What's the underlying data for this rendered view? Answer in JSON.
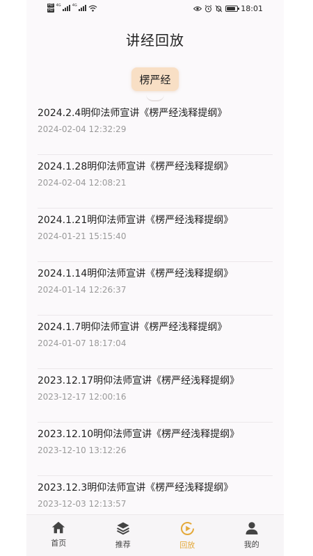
{
  "status_bar": {
    "hd_badge_1": "HD",
    "hd_badge_2": "HD",
    "net_1": "4G",
    "net_2": "4G",
    "time": "18:01",
    "battery_level": 0.85
  },
  "header": {
    "title": "讲经回放"
  },
  "category_chip": {
    "label": "楞严经"
  },
  "list": {
    "items": [
      {
        "title": "2024.2.4明仰法师宣讲《楞严经浅释提纲》",
        "date": "2024-02-04 12:32:29"
      },
      {
        "title": "2024.1.28明仰法师宣讲《楞严经浅释提纲》",
        "date": "2024-02-04 12:08:21"
      },
      {
        "title": "2024.1.21明仰法师宣讲《楞严经浅释提纲》",
        "date": "2024-01-21 15:15:40"
      },
      {
        "title": "2024.1.14明仰法师宣讲《楞严经浅释提纲》",
        "date": "2024-01-14 12:26:37"
      },
      {
        "title": "2024.1.7明仰法师宣讲《楞严经浅释提纲》",
        "date": "2024-01-07 18:17:04"
      },
      {
        "title": "2023.12.17明仰法师宣讲《楞严经浅释提纲》",
        "date": "2023-12-17 12:00:16"
      },
      {
        "title": "2023.12.10明仰法师宣讲《楞严经浅释提纲》",
        "date": "2023-12-10 13:12:26"
      },
      {
        "title": "2023.12.3明仰法师宣讲《楞严经浅释提纲》",
        "date": "2023-12-03 12:13:57"
      }
    ]
  },
  "tab_bar": {
    "tabs": [
      {
        "label": "首页",
        "icon": "home-icon"
      },
      {
        "label": "推荐",
        "icon": "layers-icon"
      },
      {
        "label": "回放",
        "icon": "play-circle-icon",
        "active": true
      },
      {
        "label": "我的",
        "icon": "user-icon"
      }
    ]
  },
  "colors": {
    "accent": "#e4a93a",
    "chip_bg": "#f8dfc5",
    "date_text": "#999999"
  }
}
